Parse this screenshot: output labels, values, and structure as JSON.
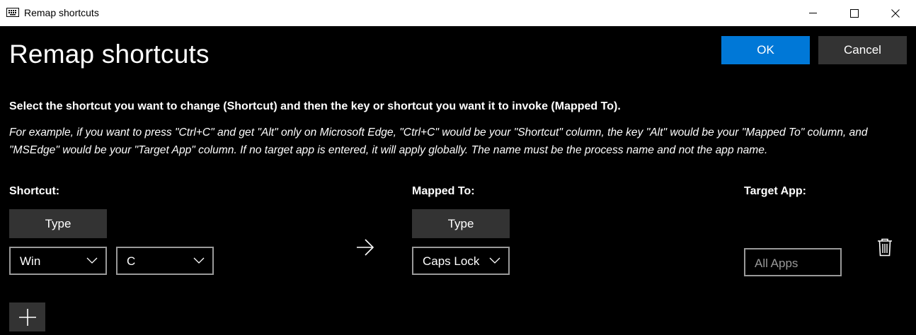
{
  "window": {
    "title": "Remap shortcuts",
    "icon": "keyboard-icon",
    "controls": [
      "minimize-icon",
      "maximize-icon",
      "close-icon"
    ]
  },
  "page": {
    "heading": "Remap shortcuts",
    "ok_label": "OK",
    "cancel_label": "Cancel",
    "instruction": "Select the shortcut you want to change (Shortcut) and then the key or shortcut you want it to invoke (Mapped To).",
    "example": "For example, if you want to press \"Ctrl+C\" and get \"Alt\" only on Microsoft Edge, \"Ctrl+C\" would be your \"Shortcut\" column, the key \"Alt\" would be your \"Mapped To\" column, and \"MSEdge\" would be your \"Target App\" column. If no target app is entered, it will apply globally. The name must be the process name and not the app name."
  },
  "columns": {
    "shortcut": "Shortcut:",
    "mapped_to": "Mapped To:",
    "target_app": "Target App:"
  },
  "row": {
    "shortcut_type_label": "Type",
    "shortcut_keys": [
      "Win",
      "C"
    ],
    "mapped_type_label": "Type",
    "mapped_key": "Caps Lock",
    "target_placeholder": "All Apps"
  },
  "icons": {
    "arrow": "arrow-right-icon",
    "delete": "trash-icon",
    "add": "plus-icon"
  },
  "colors": {
    "background": "#000000",
    "accent": "#0078d7",
    "button": "#333333",
    "border": "#999999"
  }
}
